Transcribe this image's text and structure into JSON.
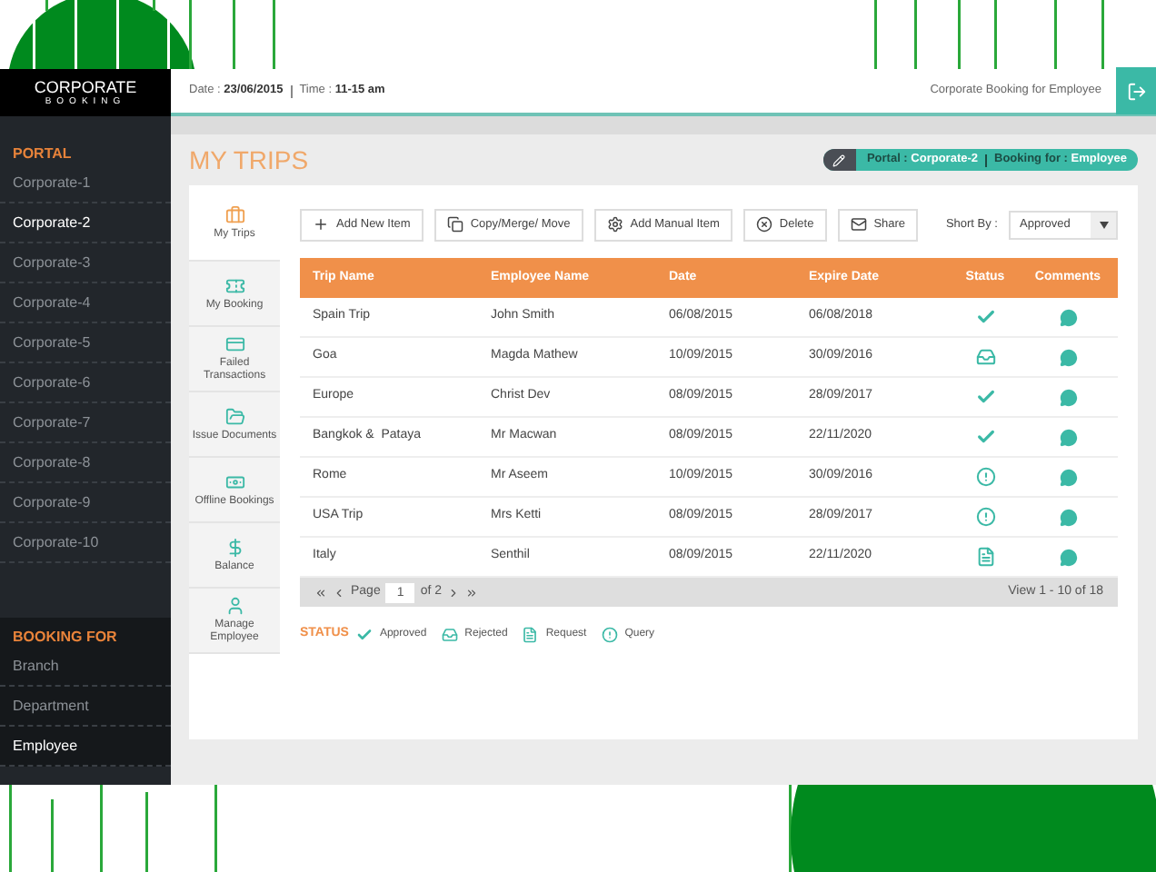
{
  "brand": {
    "title": "CORPORATE",
    "subtitle": "BOOKING"
  },
  "header": {
    "date_label": "Date :",
    "date": "23/06/2015",
    "time_label": "Time :",
    "time": "11-15 am",
    "right_text": "Corporate Booking for Employee"
  },
  "sidebar": {
    "portal_heading": "PORTAL",
    "portal_items": [
      {
        "label": "Corporate-1",
        "selected": false
      },
      {
        "label": "Corporate-2",
        "selected": true
      },
      {
        "label": "Corporate-3",
        "selected": false
      },
      {
        "label": "Corporate-4",
        "selected": false
      },
      {
        "label": "Corporate-5",
        "selected": false
      },
      {
        "label": "Corporate-6",
        "selected": false
      },
      {
        "label": "Corporate-7",
        "selected": false
      },
      {
        "label": "Corporate-8",
        "selected": false
      },
      {
        "label": "Corporate-9",
        "selected": false
      },
      {
        "label": "Corporate-10",
        "selected": false
      }
    ],
    "booking_heading": "BOOKING FOR",
    "booking_items": [
      {
        "label": "Branch",
        "selected": false
      },
      {
        "label": "Department",
        "selected": false
      },
      {
        "label": "Employee",
        "selected": true
      }
    ]
  },
  "page_title": "MY TRIPS",
  "breadcrumb": {
    "portal_label": "Portal :",
    "portal": "Corporate-2",
    "booking_label": "Booking for :",
    "booking": "Employee"
  },
  "side_tabs": [
    {
      "kind": "trips",
      "label": "My Trips",
      "selected": true
    },
    {
      "kind": "booking",
      "label": "My Booking",
      "selected": false
    },
    {
      "kind": "failed",
      "label": "Failed Transactions",
      "selected": false
    },
    {
      "kind": "documents",
      "label": "Issue Documents",
      "selected": false
    },
    {
      "kind": "offline",
      "label": "Offline Bookings",
      "selected": false
    },
    {
      "kind": "balance",
      "label": "Balance",
      "selected": false
    },
    {
      "kind": "employee",
      "label": "Manage Employee",
      "selected": false
    }
  ],
  "toolbar": [
    {
      "kind": "add",
      "label": "Add New Item"
    },
    {
      "kind": "copy",
      "label": "Copy/Merge/ Move"
    },
    {
      "kind": "manual",
      "label": "Add Manual Item"
    },
    {
      "kind": "delete",
      "label": "Delete"
    },
    {
      "kind": "share",
      "label": "Share"
    }
  ],
  "sort": {
    "label": "Short By :",
    "value": "Approved"
  },
  "table": {
    "columns": [
      "Trip Name",
      "Employee Name",
      "Date",
      "Expire Date",
      "Status",
      "Comments"
    ],
    "rows": [
      {
        "trip": "Spain Trip",
        "employee": "John Smith",
        "date": "06/08/2015",
        "expire": "06/08/2018",
        "kind": "approved"
      },
      {
        "trip": "Goa",
        "employee": "Magda Mathew",
        "date": "10/09/2015",
        "expire": "30/09/2016",
        "kind": "rejected"
      },
      {
        "trip": "Europe",
        "employee": "Christ Dev",
        "date": "08/09/2015",
        "expire": "28/09/2017",
        "kind": "approved"
      },
      {
        "trip": "Bangkok &  Pataya",
        "employee": "Mr Macwan",
        "date": "08/09/2015",
        "expire": "22/11/2020",
        "kind": "approved"
      },
      {
        "trip": "Rome",
        "employee": "Mr Aseem",
        "date": "10/09/2015",
        "expire": "30/09/2016",
        "kind": "query"
      },
      {
        "trip": "USA Trip",
        "employee": "Mrs Ketti",
        "date": "08/09/2015",
        "expire": "28/09/2017",
        "kind": "query"
      },
      {
        "trip": "Italy",
        "employee": "Senthil",
        "date": "08/09/2015",
        "expire": "22/11/2020",
        "kind": "request"
      }
    ]
  },
  "pager": {
    "page_label": "Page",
    "page": "1",
    "of": "of 2",
    "view": "View 1 - 10 of 18"
  },
  "legend": {
    "heading": "STATUS",
    "items": [
      {
        "kind": "approved",
        "label": "Approved"
      },
      {
        "kind": "rejected",
        "label": "Rejected"
      },
      {
        "kind": "request",
        "label": "Request"
      },
      {
        "kind": "query",
        "label": "Query"
      }
    ]
  }
}
